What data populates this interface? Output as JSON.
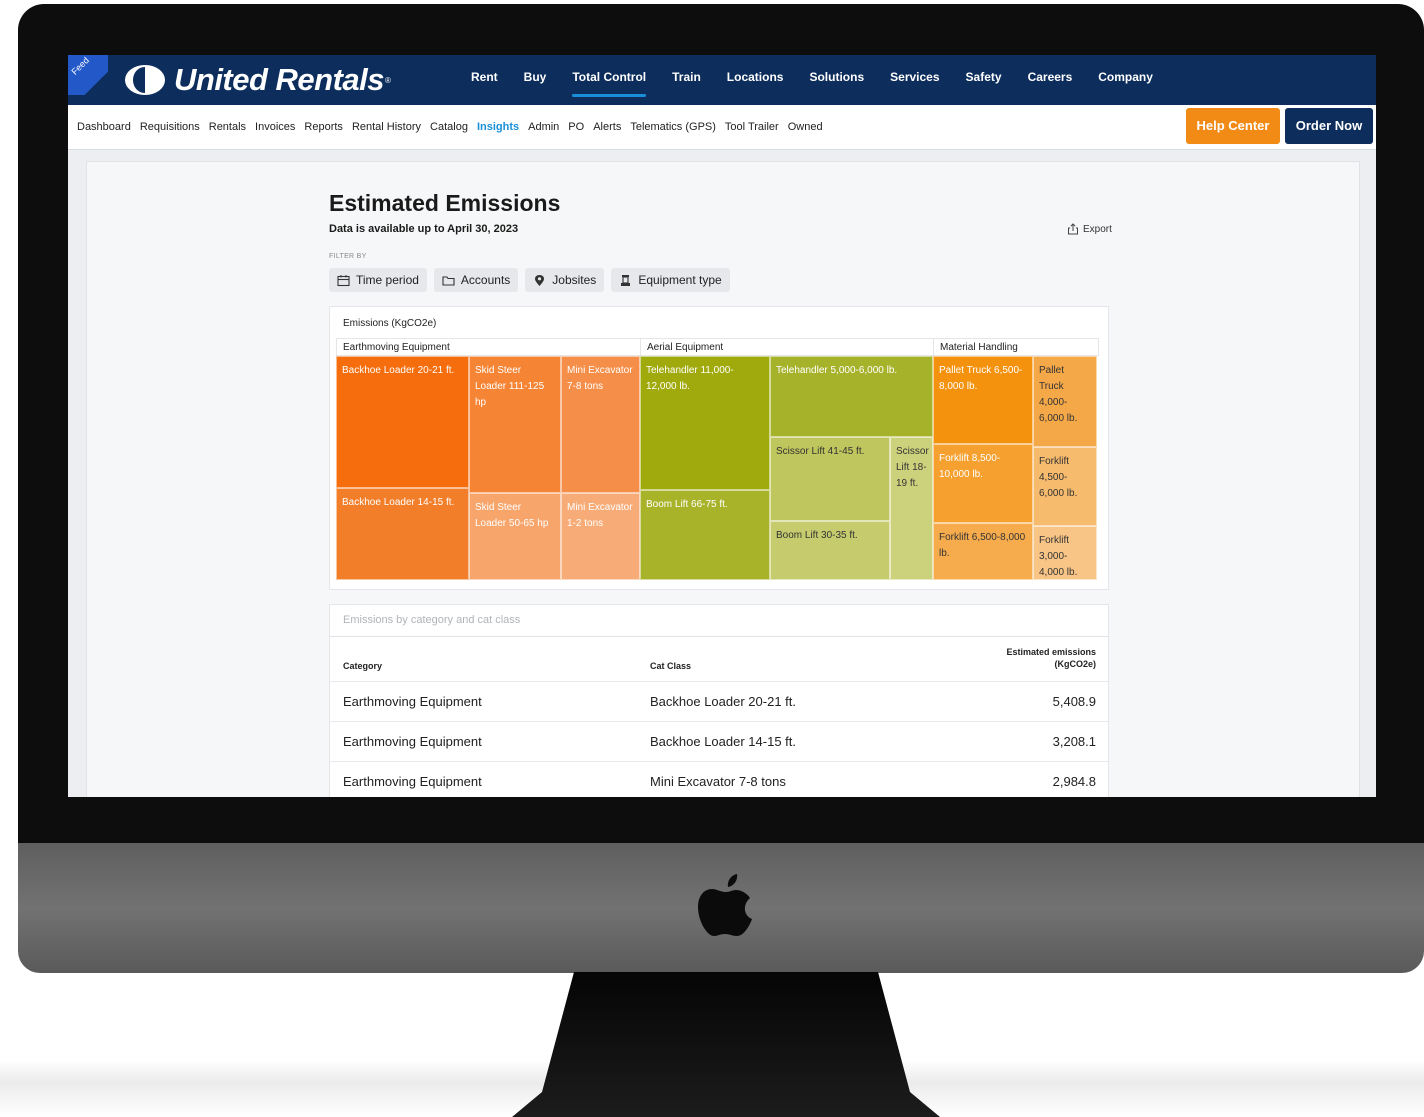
{
  "brand": {
    "ribbon_text": "Feed",
    "name": "United Rentals",
    "reg_mark": "®"
  },
  "main_nav": [
    "Rent",
    "Buy",
    "Total Control",
    "Train",
    "Locations",
    "Solutions",
    "Services",
    "Safety",
    "Careers",
    "Company"
  ],
  "main_nav_active": "Total Control",
  "sub_nav": [
    "Dashboard",
    "Requisitions",
    "Rentals",
    "Invoices",
    "Reports",
    "Rental History",
    "Catalog",
    "Insights",
    "Admin",
    "PO",
    "Alerts",
    "Telematics (GPS)",
    "Tool Trailer",
    "Owned"
  ],
  "sub_nav_active": "Insights",
  "buttons": {
    "help": "Help Center",
    "order": "Order Now"
  },
  "page": {
    "title": "Estimated Emissions",
    "subtitle": "Data is available up to April 30, 2023",
    "export_label": "Export",
    "filter_by": "FILTER BY",
    "filters": [
      "Time period",
      "Accounts",
      "Jobsites",
      "Equipment type"
    ]
  },
  "treemap": {
    "title": "Emissions (KgCO2e)",
    "groups": [
      "Earthmoving Equipment",
      "Aerial Equipment",
      "Material Handling"
    ],
    "tiles": [
      "Backhoe Loader 20-21 ft.",
      "Skid Steer Loader 111-125 hp",
      "Mini Excavator 7-8 tons",
      "Backhoe Loader 14-15 ft.",
      "Skid Steer Loader 50-65 hp",
      "Mini Excavator 1-2 tons",
      "Telehandler 11,000-12,000 lb.",
      "Telehandler 5,000-6,000 lb.",
      "Boom Lift 66-75 ft.",
      "Scissor Lift 41-45 ft.",
      "Scissor Lift 18-19 ft.",
      "Boom Lift 30-35 ft.",
      "Pallet Truck 6,500-8,000 lb.",
      "Pallet Truck 4,000-6,000 lb.",
      "Forklift 8,500-10,000 lb.",
      "Forklift 4,500-6,000 lb.",
      "Forklift 6,500-8,000 lb.",
      "Forklift 3,000-4,000 lb."
    ],
    "colors": {
      "earthmoving": "#f27013",
      "aerial": "#a3ad10",
      "material": "#f59a28"
    }
  },
  "table": {
    "title": "Emissions by category and cat class",
    "headers": {
      "category": "Category",
      "cat_class": "Cat Class",
      "emissions_1": "Estimated emissions",
      "emissions_2": "(KgCO2e)"
    },
    "rows": [
      {
        "category": "Earthmoving Equipment",
        "cat_class": "Backhoe Loader 20-21 ft.",
        "value": "5,408.9"
      },
      {
        "category": "Earthmoving Equipment",
        "cat_class": "Backhoe Loader 14-15 ft.",
        "value": "3,208.1"
      },
      {
        "category": "Earthmoving Equipment",
        "cat_class": "Mini Excavator 7-8 tons",
        "value": "2,984.8"
      }
    ]
  }
}
